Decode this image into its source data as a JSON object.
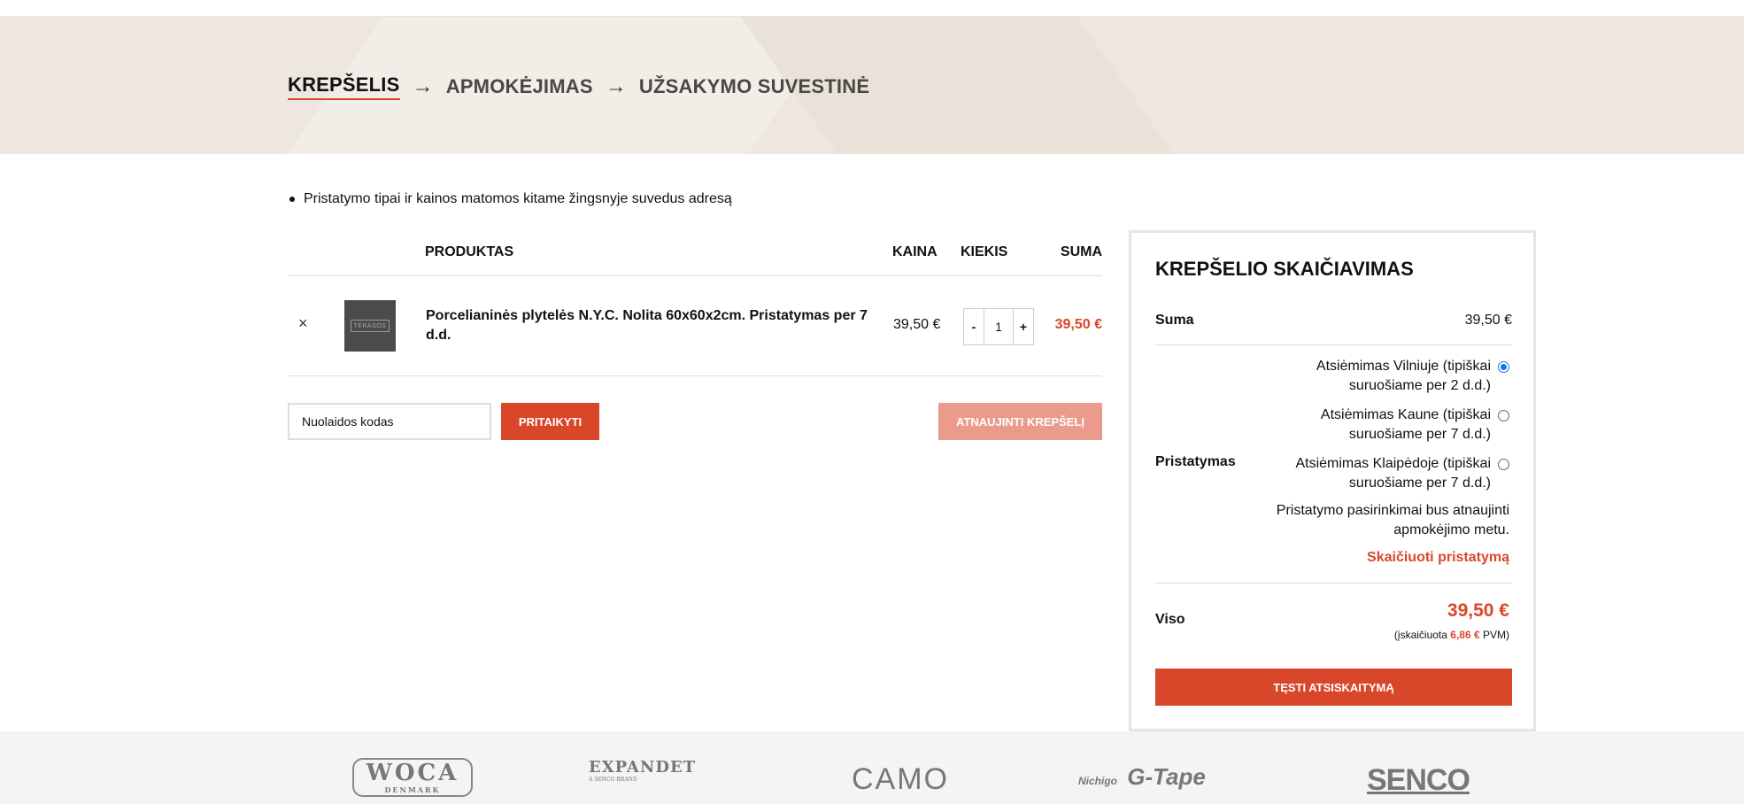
{
  "checkout_steps": {
    "step1": "KREPŠELIS",
    "arrow1": "→",
    "step2": "APMOKĖJIMAS",
    "arrow2": "→",
    "step3": "UŽSAKYMO SUVESTINĖ"
  },
  "notice": "Pristatymo tipai ir kainos matomos kitame žingsnyje suvedus adresą",
  "cart_table": {
    "headers": {
      "product": "PRODUKTAS",
      "price": "KAINA",
      "qty": "KIEKIS",
      "subtotal": "SUMA"
    },
    "items": [
      {
        "remove": "×",
        "thumb_text": "TERASOS",
        "name": "Porcelianinės plytelės N.Y.C. Nolita 60x60x2cm. Pristatymas per 7 d.d.",
        "price": "39,50 €",
        "qty_minus": "-",
        "qty": "1",
        "qty_plus": "+",
        "subtotal": "39,50 €"
      }
    ]
  },
  "coupon": {
    "placeholder": "Nuolaidos kodas",
    "apply_label": "PRITAIKYTI"
  },
  "update_cart_label": "ATNAUJINTI KREPŠELĮ",
  "totals": {
    "title": "KREPŠELIO SKAIČIAVIMAS",
    "sum_label": "Suma",
    "sum_value": "39,50 €",
    "shipping_label": "Pristatymas",
    "shipping_options": [
      {
        "label": "Atsiėmimas Vilniuje (tipiškai suruošiame per 2 d.d.)",
        "selected": true
      },
      {
        "label": "Atsiėmimas Kaune (tipiškai suruošiame per 7 d.d.)",
        "selected": false
      },
      {
        "label": "Atsiėmimas Klaipėdoje (tipiškai suruošiame per 7 d.d.)",
        "selected": false
      }
    ],
    "shipping_note": "Pristatymo pasirinkimai bus atnaujinti apmokėjimo metu.",
    "calculate_shipping": "Skaičiuoti pristatymą",
    "total_label": "Viso",
    "total_value": "39,50 €",
    "vat_prefix": "(įskaičiuota",
    "vat_amount": "6,86 €",
    "vat_suffix": "PVM)",
    "checkout_label": "TĘSTI ATSISKAITYMĄ"
  },
  "brands": {
    "woca": "WOCA",
    "woca_sub": "DENMARK",
    "expandet": "EXPANDET",
    "expandet_sub": "A SENCO BRAND",
    "camo": "CAMO",
    "gtape_prefix": "Nichigo",
    "gtape": "G-Tape",
    "senco": "SENCO"
  },
  "colors": {
    "accent": "#d9472b",
    "accent_light": "#ea9b8b",
    "banner_bg": "#ede7df"
  }
}
